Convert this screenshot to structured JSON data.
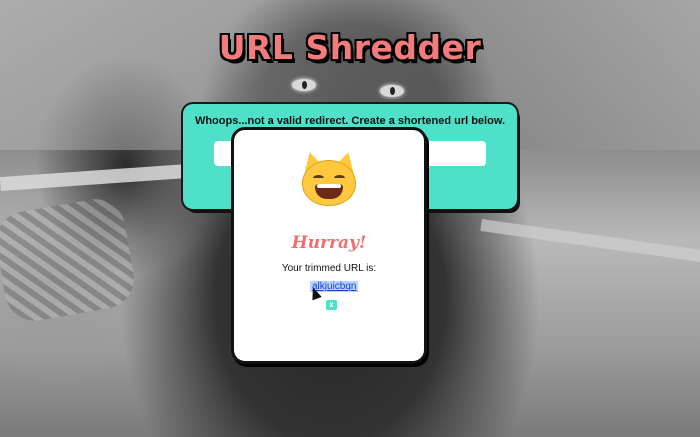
{
  "app": {
    "title": "URL Shredder"
  },
  "form": {
    "message": "Whoops...not a valid redirect. Create a shortened url below.",
    "input_value": "",
    "input_placeholder": ""
  },
  "modal": {
    "emoji": "grinning-cat-with-smiling-eyes",
    "heading": "Hurray!",
    "label": "Your trimmed URL is:",
    "short_url": "alkjuicbqn",
    "close_label": "x"
  },
  "colors": {
    "title": "#f37b7b",
    "panel": "#4ee0c9",
    "heading": "#f07070",
    "link": "#1a3fd0"
  }
}
